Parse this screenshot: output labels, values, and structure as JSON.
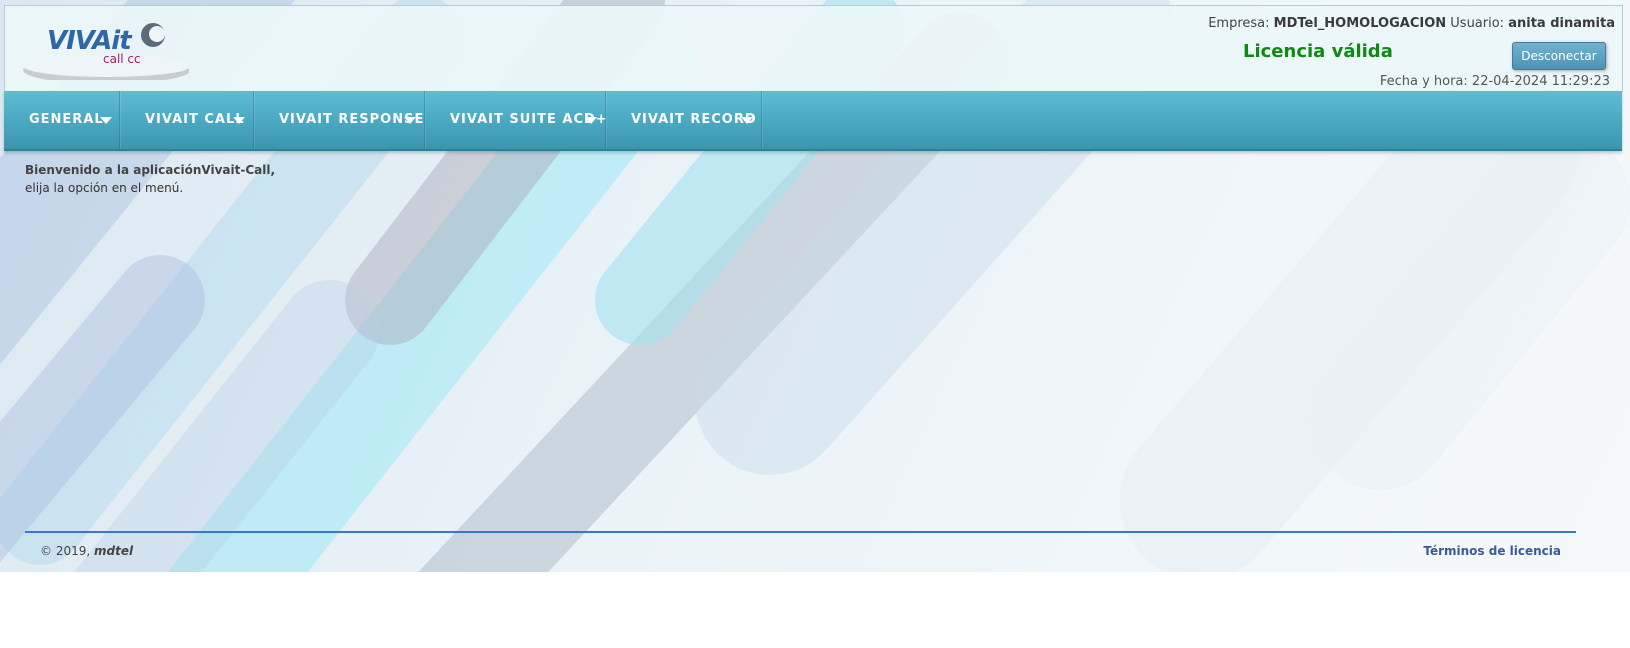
{
  "header": {
    "logo_text": "VIVAit",
    "logo_subtext": "call cc",
    "company_label": "Empresa:",
    "company_value": "MDTel_HOMOLOGACION",
    "user_label": "Usuario:",
    "user_value": "anita dinamita",
    "license_status": "Licencia válida",
    "logout_label": "Desconectar",
    "datetime_label": "Fecha y hora:",
    "datetime_value": "22-04-2024 11:29:23"
  },
  "nav": {
    "items": [
      {
        "label": "GENERAL"
      },
      {
        "label": "VIVAIT CALL"
      },
      {
        "label": "VIVAIT RESPONSE"
      },
      {
        "label": "VIVAIT SUITE ACD+"
      },
      {
        "label": "VIVAIT RECORD"
      }
    ]
  },
  "main": {
    "welcome_line1": "Bienvenido a la aplicaciónVivait-Call,",
    "welcome_line2": "elija la opción en el menú."
  },
  "footer": {
    "copyright_prefix": "© 2019,",
    "copyright_brand": "mdtel",
    "license_link": "Términos de licencia"
  },
  "colors": {
    "nav_bg": "#49a8c0",
    "license_ok": "#0d8a12",
    "footer_line": "#3b74d4",
    "link": "#3a5a9a"
  },
  "icons": {
    "nav_dropdown": "caret-down-icon"
  }
}
